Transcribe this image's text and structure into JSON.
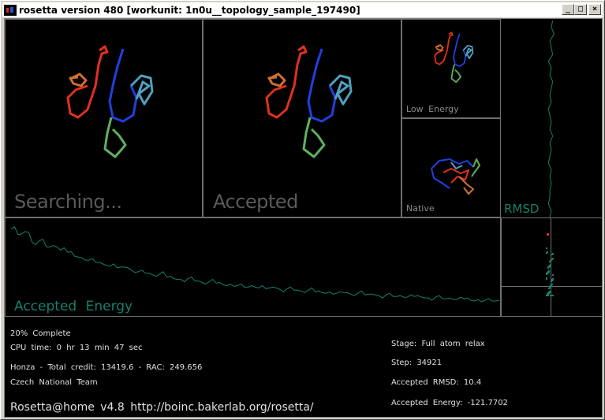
{
  "window": {
    "title": "rosetta version 480 [workunit: 1n0u__topology_sample_197490]",
    "minimize_icon": "_",
    "maximize_icon": "□",
    "close_icon": "×"
  },
  "panels": {
    "searching_label": "Searching...",
    "accepted_label": "Accepted",
    "low_energy_label": "Low Energy",
    "native_label": "Native",
    "rmsd_label": "RMSD",
    "accepted_energy_label": "Accepted Energy"
  },
  "status": {
    "percent_complete": "20% Complete",
    "cpu_time": "CPU time: 0 hr 13 min 47 sec",
    "credit_line": "Honza - Total credit: 13419.6 - RAC: 249.656",
    "team": "Czech National Team",
    "footer": "Rosetta@home v4.8 http://boinc.bakerlab.org/rosetta/",
    "stage": "Stage: Full atom relax",
    "step": "Step: 34921",
    "accepted_rmsd": "Accepted RMSD: 10.4",
    "accepted_energy": "Accepted Energy: -121.7702"
  },
  "colors": {
    "teal": "#14806a",
    "panel_border": "#6e6e6e",
    "red": "#e03020",
    "orange": "#d07030",
    "blue": "#2040e0",
    "green": "#60b060",
    "cyan": "#50a0c0"
  },
  "chart_data": [
    {
      "type": "line",
      "title": "Accepted Energy",
      "series": [
        {
          "values": [
            95,
            88,
            92,
            78,
            80,
            72,
            74,
            68,
            65,
            60,
            58,
            55,
            52,
            50,
            47,
            45,
            46,
            42,
            40,
            38,
            36,
            37,
            33,
            31,
            30,
            31,
            28,
            26,
            27,
            25,
            23,
            24,
            22,
            20,
            22,
            19,
            18,
            20,
            17,
            18,
            16,
            15,
            16,
            14,
            13,
            14,
            12,
            13,
            11,
            12,
            10,
            11,
            9,
            10,
            8,
            9,
            7,
            8,
            7,
            6,
            7,
            5,
            6,
            4,
            5,
            3,
            4,
            3,
            2,
            3
          ]
        }
      ]
    },
    {
      "type": "line",
      "title": "RMSD",
      "series": [
        {
          "values": [
            10.6,
            10.5,
            10.7,
            10.4,
            10.5,
            10.6,
            10.3,
            10.5,
            10.4,
            10.6,
            10.5,
            10.4,
            10.5,
            10.3,
            10.4,
            10.5,
            10.4,
            10.6,
            10.4,
            10.5,
            10.4,
            10.3,
            10.5,
            10.4,
            10.5,
            10.4,
            10.4,
            10.3,
            10.5,
            10.4
          ]
        }
      ]
    }
  ]
}
